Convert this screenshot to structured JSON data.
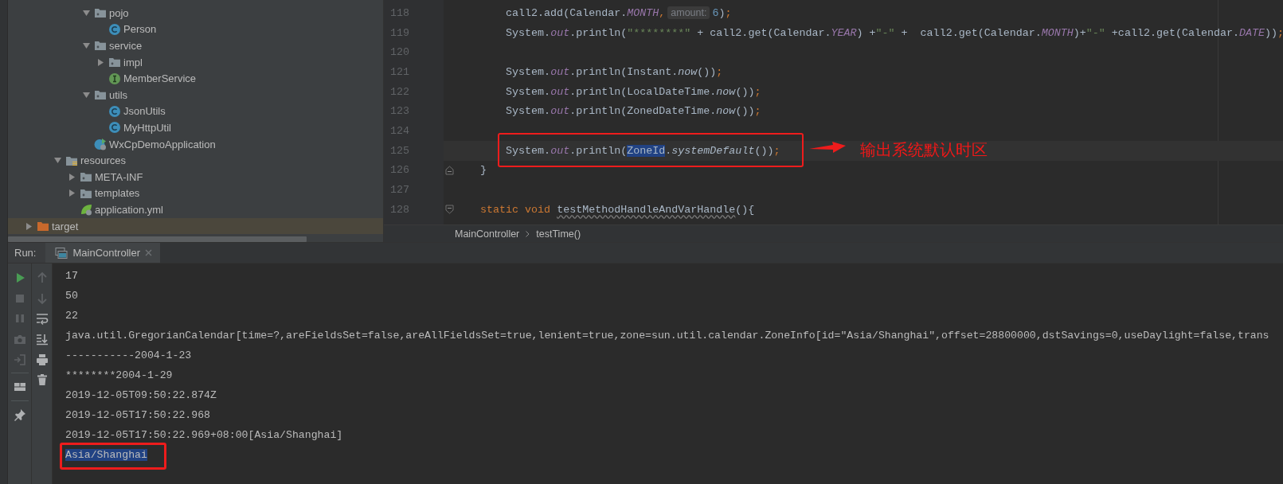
{
  "project_tree": {
    "items": [
      {
        "children": [
          {
            "children": [
              {
                "children": [
                  {
                    "children": [
                      {
                        "label": "pojo",
                        "kind": "package",
                        "expanded": true,
                        "selected": false,
                        "children": [
                          {
                            "label": "Person",
                            "kind": "class",
                            "selected": false
                          }
                        ]
                      },
                      {
                        "label": "service",
                        "kind": "package",
                        "expanded": true,
                        "selected": false,
                        "children": [
                          {
                            "label": "impl",
                            "kind": "package",
                            "expanded": false,
                            "selected": false
                          },
                          {
                            "label": "MemberService",
                            "kind": "interface",
                            "selected": false
                          }
                        ]
                      },
                      {
                        "label": "utils",
                        "kind": "package",
                        "expanded": true,
                        "selected": false,
                        "children": [
                          {
                            "label": "JsonUtils",
                            "kind": "class",
                            "selected": false
                          },
                          {
                            "label": "MyHttpUtil",
                            "kind": "class",
                            "selected": false
                          }
                        ]
                      },
                      {
                        "label": "WxCpDemoApplication",
                        "kind": "spring-class",
                        "selected": false
                      }
                    ]
                  }
                ]
              },
              {
                "label": "resources",
                "kind": "resources",
                "expanded": true,
                "selected": false,
                "children": [
                  {
                    "label": "META-INF",
                    "kind": "package",
                    "expanded": false,
                    "selected": false
                  },
                  {
                    "label": "templates",
                    "kind": "package",
                    "expanded": false,
                    "selected": false
                  },
                  {
                    "label": "application.yml",
                    "kind": "spring-config",
                    "selected": false
                  }
                ]
              }
            ]
          }
        ]
      },
      {
        "label": "target",
        "kind": "excluded",
        "expanded": false,
        "selected": true
      }
    ]
  },
  "editor": {
    "lines": [
      {
        "number": "118",
        "current": false,
        "boxed": false,
        "tokens": [
          {
            "text": "        call2.add(Calendar.",
            "kind": "plain"
          },
          {
            "text": "MONTH",
            "kind": "static"
          },
          {
            "text": ",",
            "kind": "keyword"
          },
          {
            "text": "amount:",
            "kind": "hint"
          },
          {
            "text": "6",
            "kind": "number"
          },
          {
            "text": ")",
            "kind": "plain"
          },
          {
            "text": ";",
            "kind": "keyword"
          }
        ]
      },
      {
        "number": "119",
        "current": false,
        "boxed": false,
        "tokens": [
          {
            "text": "        System.",
            "kind": "plain"
          },
          {
            "text": "out",
            "kind": "static"
          },
          {
            "text": ".println(",
            "kind": "plain"
          },
          {
            "text": "\"********\"",
            "kind": "string"
          },
          {
            "text": " + call2.get(Calendar.",
            "kind": "plain"
          },
          {
            "text": "YEAR",
            "kind": "static"
          },
          {
            "text": ") +",
            "kind": "plain"
          },
          {
            "text": "\"-\"",
            "kind": "string"
          },
          {
            "text": " +  call2.get(Calendar.",
            "kind": "plain"
          },
          {
            "text": "MONTH",
            "kind": "static"
          },
          {
            "text": ")+",
            "kind": "plain"
          },
          {
            "text": "\"-\"",
            "kind": "string"
          },
          {
            "text": " +call2.get(Calendar.",
            "kind": "plain"
          },
          {
            "text": "DATE",
            "kind": "static"
          },
          {
            "text": "))",
            "kind": "plain"
          },
          {
            "text": ";",
            "kind": "keyword"
          }
        ]
      },
      {
        "number": "120",
        "current": false,
        "boxed": false
      },
      {
        "number": "121",
        "current": false,
        "boxed": false,
        "tokens": [
          {
            "text": "        System.",
            "kind": "plain"
          },
          {
            "text": "out",
            "kind": "static"
          },
          {
            "text": ".println(Instant.",
            "kind": "plain"
          },
          {
            "text": "now",
            "kind": "italic"
          },
          {
            "text": "())",
            "kind": "plain"
          },
          {
            "text": ";",
            "kind": "keyword"
          }
        ]
      },
      {
        "number": "122",
        "current": false,
        "boxed": false,
        "tokens": [
          {
            "text": "        System.",
            "kind": "plain"
          },
          {
            "text": "out",
            "kind": "static"
          },
          {
            "text": ".println(LocalDateTime.",
            "kind": "plain"
          },
          {
            "text": "now",
            "kind": "italic"
          },
          {
            "text": "())",
            "kind": "plain"
          },
          {
            "text": ";",
            "kind": "keyword"
          }
        ]
      },
      {
        "number": "123",
        "current": false,
        "boxed": false,
        "tokens": [
          {
            "text": "        System.",
            "kind": "plain"
          },
          {
            "text": "out",
            "kind": "static"
          },
          {
            "text": ".println(ZonedDateTime.",
            "kind": "plain"
          },
          {
            "text": "now",
            "kind": "italic"
          },
          {
            "text": "())",
            "kind": "plain"
          },
          {
            "text": ";",
            "kind": "keyword"
          }
        ]
      },
      {
        "number": "124",
        "current": false,
        "boxed": false
      },
      {
        "number": "125",
        "current": true,
        "boxed": true,
        "callout": "输出系统默认时区",
        "tokens": [
          {
            "text": "        System.",
            "kind": "plain"
          },
          {
            "text": "out",
            "kind": "static"
          },
          {
            "text": ".println(",
            "kind": "plain"
          },
          {
            "text": "ZoneId",
            "kind": "selection"
          },
          {
            "text": ".",
            "kind": "plain"
          },
          {
            "text": "systemDefault",
            "kind": "italic"
          },
          {
            "text": "())",
            "kind": "plain"
          },
          {
            "text": ";",
            "kind": "keyword"
          }
        ]
      },
      {
        "number": "126",
        "current": false,
        "boxed": false,
        "fold": {
          "kind": "end"
        },
        "tokens": [
          {
            "text": "    }",
            "kind": "plain"
          }
        ]
      },
      {
        "number": "127",
        "current": false,
        "boxed": false
      },
      {
        "number": "128",
        "current": false,
        "boxed": false,
        "fold": {
          "kind": "start"
        },
        "tokens": [
          {
            "text": "    static void ",
            "kind": "keyword"
          },
          {
            "text": "testMethodHandleAndVarHandle",
            "kind": "unused"
          },
          {
            "text": "(){",
            "kind": "plain"
          }
        ]
      }
    ],
    "breadcrumb": [
      "MainController",
      "testTime()"
    ]
  },
  "run_window": {
    "label": "Run:",
    "tabs": [
      {
        "label": "MainController",
        "selected": true
      }
    ],
    "toolbar": [
      {
        "kind": "rerun",
        "disabled": false
      },
      {
        "kind": "stop",
        "disabled": true
      },
      {
        "kind": "pause",
        "disabled": true
      },
      {
        "kind": "dump",
        "disabled": true
      },
      {
        "kind": "exit",
        "disabled": true
      },
      {
        "kind": "separator"
      },
      {
        "kind": "layout",
        "disabled": false
      },
      {
        "kind": "separator"
      },
      {
        "kind": "pin",
        "disabled": false
      }
    ],
    "console_toolbar": [
      {
        "kind": "up",
        "disabled": true
      },
      {
        "kind": "down",
        "disabled": true
      },
      {
        "kind": "wrap",
        "disabled": false
      },
      {
        "kind": "scroll-end",
        "disabled": false
      },
      {
        "kind": "print",
        "disabled": false
      },
      {
        "kind": "clear",
        "disabled": false
      }
    ],
    "console": [
      {
        "text": "17",
        "selected": false,
        "boxed": false
      },
      {
        "text": "50",
        "selected": false,
        "boxed": false
      },
      {
        "text": "22",
        "selected": false,
        "boxed": false
      },
      {
        "text": "java.util.GregorianCalendar[time=?,areFieldsSet=false,areAllFieldsSet=true,lenient=true,zone=sun.util.calendar.ZoneInfo[id=\"Asia/Shanghai\",offset=28800000,dstSavings=0,useDaylight=false,trans",
        "selected": false,
        "boxed": false
      },
      {
        "text": "-----------2004-1-23",
        "selected": false,
        "boxed": false
      },
      {
        "text": "********2004-1-29",
        "selected": false,
        "boxed": false
      },
      {
        "text": "2019-12-05T09:50:22.874Z",
        "selected": false,
        "boxed": false
      },
      {
        "text": "2019-12-05T17:50:22.968",
        "selected": false,
        "boxed": false
      },
      {
        "text": "2019-12-05T17:50:22.969+08:00[Asia/Shanghai]",
        "selected": false,
        "boxed": false
      },
      {
        "text": "Asia/Shanghai",
        "selected": true,
        "boxed": true
      }
    ]
  }
}
